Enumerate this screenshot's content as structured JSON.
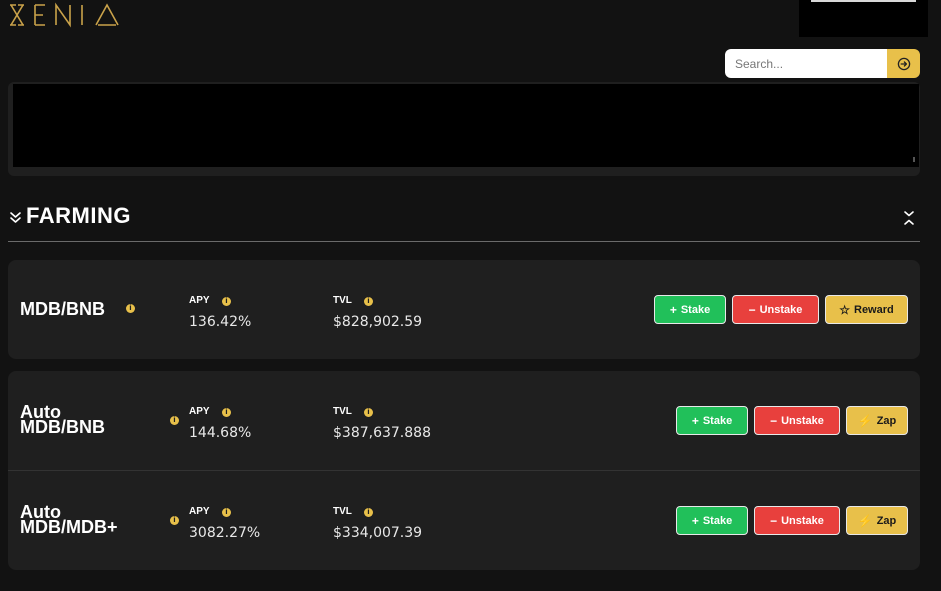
{
  "app": {
    "logo_text": "XENIA"
  },
  "search": {
    "placeholder": "Search..."
  },
  "section": {
    "title": "FARMING"
  },
  "pools": [
    {
      "name_line1": "MDB/BNB",
      "name_line2": "",
      "apy_label": "APY",
      "apy": "136.42%",
      "tvl_label": "TVL",
      "tvl": "$828,902.59",
      "stake_label": "Stake",
      "unstake_label": "Unstake",
      "extra_label": "Reward",
      "extra_icon": "star-icon"
    },
    {
      "name_line1": "Auto",
      "name_line2": "MDB/BNB",
      "apy_label": "APY",
      "apy": "144.68%",
      "tvl_label": "TVL",
      "tvl": "$387,637.888",
      "stake_label": "Stake",
      "unstake_label": "Unstake",
      "extra_label": "Zap",
      "extra_icon": "bolt-icon"
    },
    {
      "name_line1": "Auto",
      "name_line2": "MDB/MDB+",
      "apy_label": "APY",
      "apy": "3082.27%",
      "tvl_label": "TVL",
      "tvl": "$334,007.39",
      "stake_label": "Stake",
      "unstake_label": "Unstake",
      "extra_label": "Zap",
      "extra_icon": "bolt-icon"
    }
  ],
  "colors": {
    "accent": "#e8c04a",
    "stake": "#21c05a",
    "unstake": "#e8403d",
    "card": "#1f1f1f",
    "background": "#121212"
  }
}
